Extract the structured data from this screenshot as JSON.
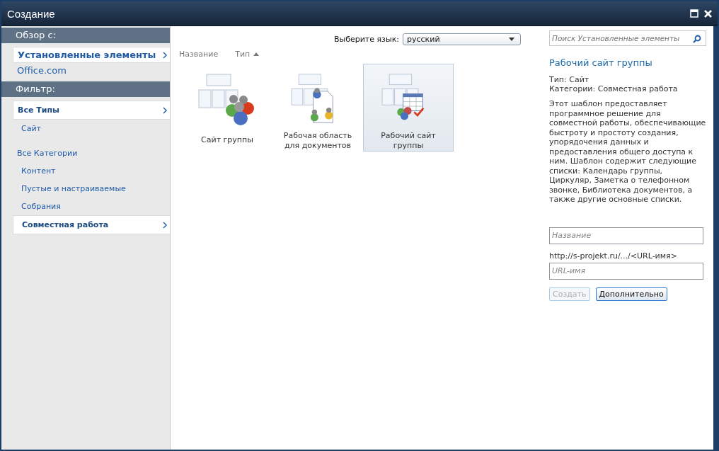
{
  "window": {
    "title": "Создание"
  },
  "sidebar": {
    "sections": [
      {
        "title": "Обзор с:",
        "items": [
          {
            "label": "Установленные элементы",
            "selected": true
          },
          {
            "label": "Office.com",
            "selected": false
          }
        ]
      },
      {
        "title": "Фильтр:",
        "items": [
          {
            "label": "Все Типы",
            "selected": true,
            "children": [
              {
                "label": "Сайт",
                "selected": false
              }
            ]
          },
          {
            "label": "Все Категории",
            "selected": false,
            "children": [
              {
                "label": "Контент",
                "selected": false
              },
              {
                "label": "Пустые и настраиваемые",
                "selected": false
              },
              {
                "label": "Собрания",
                "selected": false
              },
              {
                "label": "Совместная работа",
                "selected": true
              }
            ]
          }
        ]
      }
    ]
  },
  "language": {
    "label": "Выберите язык:",
    "value": "русский"
  },
  "sort": {
    "columns": [
      {
        "label": "Название",
        "sorted": false
      },
      {
        "label": "Тип",
        "sorted": true
      }
    ]
  },
  "templates": [
    {
      "label": "Сайт группы",
      "selected": false
    },
    {
      "label": "Рабочая область для документов",
      "selected": false
    },
    {
      "label": "Рабочий сайт группы",
      "selected": true
    }
  ],
  "details": {
    "search_placeholder": "Поиск Установленные элементы",
    "title": "Рабочий сайт группы",
    "type": "Тип: Сайт",
    "categories": "Категории: Совместная работа",
    "description": "Этот шаблон предоставляет программное решение для совместной работы, обеспечивающие быстроту и простоту создания, упорядочения данных и предоставления общего доступа к ним. Шаблон содержит следующие списки: Календарь группы, Циркуляр, Заметка о телефонном звонке, Библиотека документов, а также другие основные списки.",
    "name_placeholder": "Название",
    "url_prefix": "http://s-projekt.ru/.../<URL-имя>",
    "url_placeholder": "URL-имя",
    "buttons": [
      {
        "label": "Создать",
        "disabled": true
      },
      {
        "label": "Дополнительно",
        "disabled": false
      }
    ]
  }
}
